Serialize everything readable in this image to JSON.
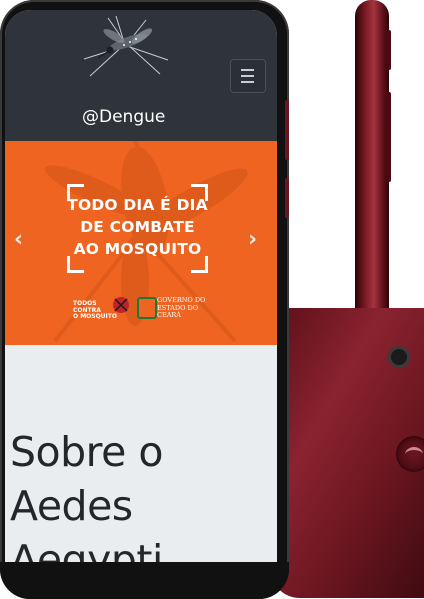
{
  "colors": {
    "header_bg": "#2f343b",
    "banner_bg": "#ef6420",
    "content_bg": "#eaedf0",
    "phone_accent": "#7a1a24"
  },
  "header": {
    "brand": "@Dengue",
    "menu_icon": "hamburger-icon",
    "logo_icon": "mosquito-icon"
  },
  "carousel": {
    "banner_lines": [
      "TODO DIA É DIA",
      "DE COMBATE",
      "AO MOSQUITO"
    ],
    "prev_glyph": "‹",
    "next_glyph": "›",
    "partners": {
      "campaign_line1": "TODOS",
      "campaign_line2": "CONTRA",
      "campaign_line3": "O MOSQUITO",
      "gov_line1": "GOVERNO DO",
      "gov_line2": "ESTADO DO CEARÁ"
    }
  },
  "main": {
    "title": "Sobre o Aedes Aegypti"
  }
}
